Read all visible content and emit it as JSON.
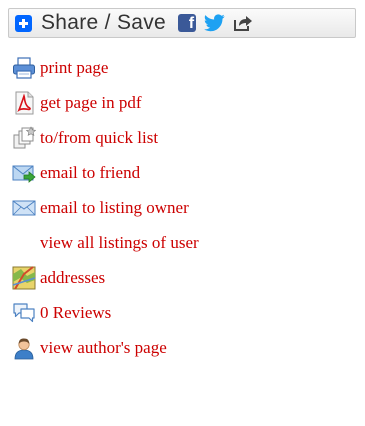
{
  "share": {
    "label": "Share / Save",
    "facebook_glyph": "f",
    "icons": [
      "plus-icon",
      "facebook-icon",
      "twitter-icon",
      "share-arrow-icon"
    ]
  },
  "links": [
    {
      "label": "print page",
      "icon": "printer-icon"
    },
    {
      "label": "get page in pdf",
      "icon": "pdf-icon"
    },
    {
      "label": "to/from quick list",
      "icon": "quick-list-icon"
    },
    {
      "label": "email to friend",
      "icon": "email-forward-icon"
    },
    {
      "label": "email to listing owner",
      "icon": "envelope-icon"
    },
    {
      "label": "view all listings of user",
      "icon": ""
    },
    {
      "label": "addresses",
      "icon": "map-icon"
    },
    {
      "label": "0 Reviews",
      "icon": "comments-icon"
    },
    {
      "label": "view author's page",
      "icon": "user-icon"
    }
  ],
  "colors": {
    "link": "#cc0000",
    "share_text": "#333333",
    "share_plus": "#0166ff",
    "facebook": "#3b5998",
    "twitter": "#1da1f2"
  }
}
